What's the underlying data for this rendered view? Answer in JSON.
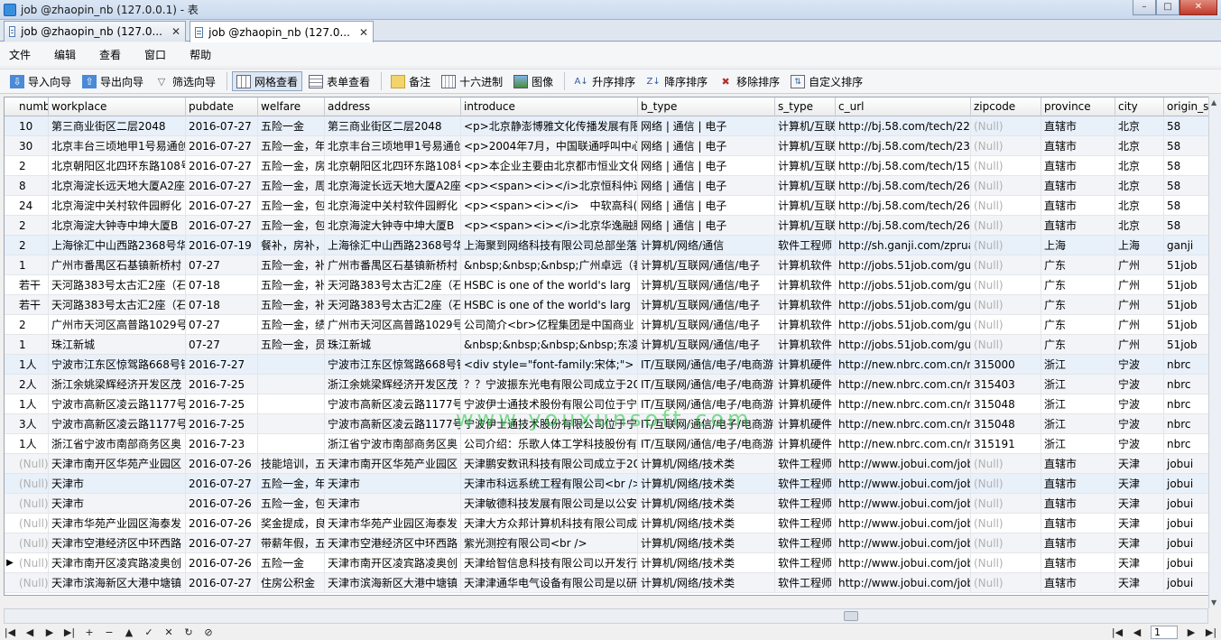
{
  "window": {
    "title": "job @zhaopin_nb (127.0.0.1) - 表",
    "controls": [
      "–",
      "□",
      "✕"
    ]
  },
  "tabs": [
    {
      "label": "job @zhaopin_nb (127.0...",
      "close": "✕",
      "active": false
    },
    {
      "label": "job @zhaopin_nb (127.0...",
      "close": "✕",
      "active": true
    }
  ],
  "menu": [
    "文件",
    "编辑",
    "查看",
    "窗口",
    "帮助"
  ],
  "toolbar": {
    "import_wizard": "导入向导",
    "export_wizard": "导出向导",
    "filter_wizard": "筛选向导",
    "grid_view": "网格查看",
    "form_view": "表单查看",
    "memo": "备注",
    "hex": "十六进制",
    "image": "图像",
    "sort_asc": "升序排序",
    "sort_desc": "降序排序",
    "remove_sort": "移除排序",
    "custom_sort": "自定义排序"
  },
  "icons": {
    "import": "import-icon",
    "export": "export-icon",
    "filter": "filter-icon",
    "grid": "grid-icon",
    "form": "form-icon",
    "memo": "memo-icon",
    "hex": "hex-icon",
    "image": "image-icon",
    "asc": "sort-asc-icon",
    "desc": "sort-desc-icon",
    "remove": "remove-sort-icon",
    "custom": "custom-sort-icon"
  },
  "columns": [
    "numb",
    "workplace",
    "pubdate",
    "welfare",
    "address",
    "introduce",
    "b_type",
    "s_type",
    "c_url",
    "zipcode",
    "province",
    "city",
    "origin_site"
  ],
  "rows": [
    [
      "10",
      "第三商业街区二层2048",
      "2016-07-27",
      "五险一金",
      "第三商业街区二层2048",
      "<p>北京静澎博雅文化传播发展有限",
      "网络 | 通信 | 电子",
      "计算机/互联",
      "http://bj.58.com/tech/221",
      "(Null)",
      "直辖市",
      "北京",
      "58"
    ],
    [
      "30",
      "北京丰台三顷地甲1号易通创",
      "2016-07-27",
      "五险一金，年",
      "北京丰台三顷地甲1号易通创",
      "<p>2004年7月，中国联通呼叫中心",
      "网络 | 通信 | 电子",
      "计算机/互联",
      "http://bj.58.com/tech/234",
      "(Null)",
      "直辖市",
      "北京",
      "58"
    ],
    [
      "2",
      "北京朝阳区北四环东路108号",
      "2016-07-27",
      "五险一金，房",
      "北京朝阳区北四环东路108号",
      "<p>本企业主要由北京都市恒业文化",
      "网络 | 通信 | 电子",
      "计算机/互联",
      "http://bj.58.com/tech/153",
      "(Null)",
      "直辖市",
      "北京",
      "58"
    ],
    [
      "8",
      "北京海淀长远天地大厦A2座",
      "2016-07-27",
      "五险一金，周",
      "北京海淀长远天地大厦A2座",
      "<p><span><i></i>北京恒科仲达",
      "网络 | 通信 | 电子",
      "计算机/互联",
      "http://bj.58.com/tech/267",
      "(Null)",
      "直辖市",
      "北京",
      "58"
    ],
    [
      "24",
      "北京海淀中关村软件园孵化",
      "2016-07-27",
      "五险一金，包",
      "北京海淀中关村软件园孵化",
      "<p><span><i></i>　中软高科(北",
      "网络 | 通信 | 电子",
      "计算机/互联",
      "http://bj.58.com/tech/265",
      "(Null)",
      "直辖市",
      "北京",
      "58"
    ],
    [
      "2",
      "北京海淀大钟寺中坤大厦B",
      "2016-07-27",
      "五险一金，包",
      "北京海淀大钟寺中坤大厦B",
      "<p><span><i></i>北京华逸融腾",
      "网络 | 通信 | 电子",
      "计算机/互联",
      "http://bj.58.com/tech/266",
      "(Null)",
      "直辖市",
      "北京",
      "58"
    ],
    [
      "2",
      "上海徐汇中山西路2368号华",
      "2016-07-19",
      "餐补，房补，",
      "上海徐汇中山西路2368号华",
      "上海聚到网络科技有限公司总部坐落",
      "计算机/网络/通信",
      "软件工程师",
      "http://sh.ganji.com/zprua",
      "(Null)",
      "上海",
      "上海",
      "ganji"
    ],
    [
      "1",
      "广州市番禺区石基镇新桥村",
      "07-27",
      "五险一金，补",
      "广州市番禺区石基镇新桥村",
      "&nbsp;&nbsp;&nbsp;广州卓远（番",
      "计算机/互联网/通信/电子",
      "计算机软件",
      "http://jobs.51job.com/gu",
      "(Null)",
      "广东",
      "广州",
      "51job"
    ],
    [
      "若干",
      "天河路383号太古汇2座（石",
      "07-18",
      "五险一金，补",
      "天河路383号太古汇2座（石",
      "HSBC is one of the world's larg",
      "计算机/互联网/通信/电子",
      "计算机软件",
      "http://jobs.51job.com/gu",
      "(Null)",
      "广东",
      "广州",
      "51job"
    ],
    [
      "若干",
      "天河路383号太古汇2座（石",
      "07-18",
      "五险一金，补",
      "天河路383号太古汇2座（石",
      "HSBC is one of the world's larg",
      "计算机/互联网/通信/电子",
      "计算机软件",
      "http://jobs.51job.com/gu",
      "(Null)",
      "广东",
      "广州",
      "51job"
    ],
    [
      "2",
      "广州市天河区高普路1029号",
      "07-27",
      "五险一金，绩",
      "广州市天河区高普路1029号",
      "公司简介<br>亿程集团是中国商业",
      "计算机/互联网/通信/电子",
      "计算机软件",
      "http://jobs.51job.com/gu",
      "(Null)",
      "广东",
      "广州",
      "51job"
    ],
    [
      "1",
      "珠江新城",
      "07-27",
      "五险一金，员",
      "珠江新城",
      "&nbsp;&nbsp;&nbsp;&nbsp;东凌",
      "计算机/互联网/通信/电子",
      "计算机软件",
      "http://jobs.51job.com/gu",
      "(Null)",
      "广东",
      "广州",
      "51job"
    ],
    [
      "1人",
      "宁波市江东区惊驾路668号银",
      "2016-7-27",
      "",
      "宁波市江东区惊驾路668号银",
      "<div style=\"font-family:宋体;\">",
      "IT/互联网/通信/电子/电商游",
      "计算机硬件",
      "http://new.nbrc.com.cn/nl",
      "315000",
      "浙江",
      "宁波",
      "nbrc"
    ],
    [
      "2人",
      "浙江余姚梁辉经济开发区茂",
      "2016-7-25",
      "",
      "浙江余姚梁辉经济开发区茂",
      "？？宁波振东光电有限公司成立于20",
      "IT/互联网/通信/电子/电商游",
      "计算机硬件",
      "http://new.nbrc.com.cn/nl",
      "315403",
      "浙江",
      "宁波",
      "nbrc"
    ],
    [
      "1人",
      "宁波市高新区凌云路1177号",
      "2016-7-25",
      "",
      "宁波市高新区凌云路1177号",
      "宁波伊士通技术股份有限公司位于宁",
      "IT/互联网/通信/电子/电商游",
      "计算机硬件",
      "http://new.nbrc.com.cn/nl",
      "315048",
      "浙江",
      "宁波",
      "nbrc"
    ],
    [
      "3人",
      "宁波市高新区凌云路1177号",
      "2016-7-25",
      "",
      "宁波市高新区凌云路1177号",
      "宁波伊士通技术股份有限公司位于宁",
      "IT/互联网/通信/电子/电商游",
      "计算机硬件",
      "http://new.nbrc.com.cn/nl",
      "315048",
      "浙江",
      "宁波",
      "nbrc"
    ],
    [
      "1人",
      "浙江省宁波市南部商务区奥",
      "2016-7-23",
      "",
      "浙江省宁波市南部商务区奥",
      "公司介绍：乐歌人体工学科技股份有",
      "IT/互联网/通信/电子/电商游",
      "计算机硬件",
      "http://new.nbrc.com.cn/nl",
      "315191",
      "浙江",
      "宁波",
      "nbrc"
    ],
    [
      "(Null)",
      "天津市南开区华苑产业园区",
      "2016-07-26",
      "技能培训，五",
      "天津市南开区华苑产业园区",
      "天津鹏安数讯科技有限公司成立于20",
      "计算机/网络/技术类",
      "软件工程师",
      "http://www.jobui.com/job",
      "(Null)",
      "直辖市",
      "天津",
      "jobui"
    ],
    [
      "(Null)",
      "天津市",
      "2016-07-27",
      "五险一金，年",
      "天津市",
      "天津市科远系统工程有限公司<br />",
      "计算机/网络/技术类",
      "软件工程师",
      "http://www.jobui.com/job",
      "(Null)",
      "直辖市",
      "天津",
      "jobui"
    ],
    [
      "(Null)",
      "天津市",
      "2016-07-26",
      "五险一金，包",
      "天津市",
      "天津敏德科技发展有限公司是以公安",
      "计算机/网络/技术类",
      "软件工程师",
      "http://www.jobui.com/job",
      "(Null)",
      "直辖市",
      "天津",
      "jobui"
    ],
    [
      "(Null)",
      "天津市华苑产业园区海泰发",
      "2016-07-26",
      "奖金提成，良",
      "天津市华苑产业园区海泰发",
      "天津大方众邦计算机科技有限公司成",
      "计算机/网络/技术类",
      "软件工程师",
      "http://www.jobui.com/job",
      "(Null)",
      "直辖市",
      "天津",
      "jobui"
    ],
    [
      "(Null)",
      "天津市空港经济区中环西路",
      "2016-07-27",
      "带薪年假，五",
      "天津市空港经济区中环西路",
      "紫光测控有限公司<br />",
      "计算机/网络/技术类",
      "软件工程师",
      "http://www.jobui.com/job",
      "(Null)",
      "直辖市",
      "天津",
      "jobui"
    ],
    [
      "(Null)",
      "天津市南开区凌宾路凌奥创",
      "2016-07-26",
      "五险一金",
      "天津市南开区凌宾路凌奥创",
      "天津给智信息科技有限公司以开发行",
      "计算机/网络/技术类",
      "软件工程师",
      "http://www.jobui.com/job",
      "(Null)",
      "直辖市",
      "天津",
      "jobui"
    ],
    [
      "(Null)",
      "天津市滨海新区大港中塘镇",
      "2016-07-27",
      "住房公积金",
      "天津市滨海新区大港中塘镇",
      "天津津通华电气设备有限公司是以研",
      "计算机/网络/技术类",
      "软件工程师",
      "http://www.jobui.com/job",
      "(Null)",
      "直辖市",
      "天津",
      "jobui"
    ]
  ],
  "watermark": "www.youxunsoft.com",
  "navigator": {
    "buttons": [
      "|◀",
      "◀",
      "▶",
      "▶|",
      "+",
      "−",
      "▲",
      "✓",
      "✕",
      "↻",
      "⊘"
    ],
    "page": "1"
  }
}
